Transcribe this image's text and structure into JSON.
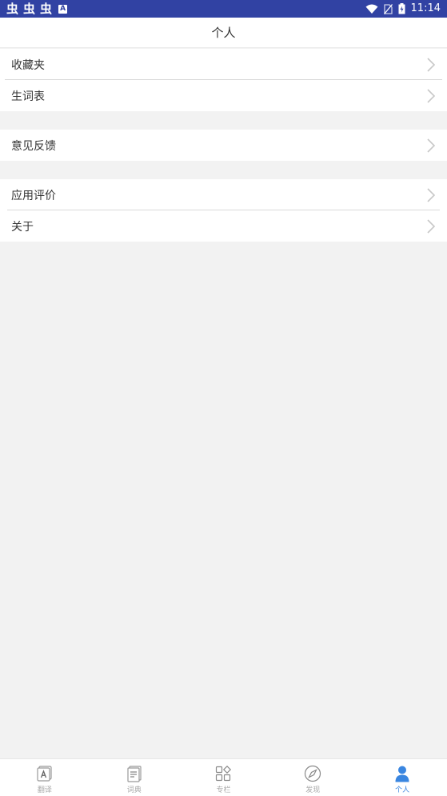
{
  "status_bar": {
    "left_glyphs": [
      "虫",
      "虫",
      "虫"
    ],
    "badge": "A",
    "time": "11:14"
  },
  "header": {
    "title": "个人"
  },
  "groups": [
    {
      "items": [
        {
          "label": "收藏夹"
        },
        {
          "label": "生词表"
        }
      ]
    },
    {
      "items": [
        {
          "label": "意见反馈"
        }
      ]
    },
    {
      "items": [
        {
          "label": "应用评价"
        },
        {
          "label": "关于"
        }
      ]
    }
  ],
  "tab_bar": {
    "tabs": [
      {
        "label": "翻译",
        "icon": "translate-icon"
      },
      {
        "label": "词典",
        "icon": "dictionary-icon"
      },
      {
        "label": "专栏",
        "icon": "columns-icon"
      },
      {
        "label": "发现",
        "icon": "compass-icon"
      },
      {
        "label": "个人",
        "icon": "person-icon"
      }
    ],
    "active_index": 4
  },
  "colors": {
    "status_bar": "#3142a3",
    "accent": "#3a86e0",
    "background": "#f2f2f2"
  }
}
